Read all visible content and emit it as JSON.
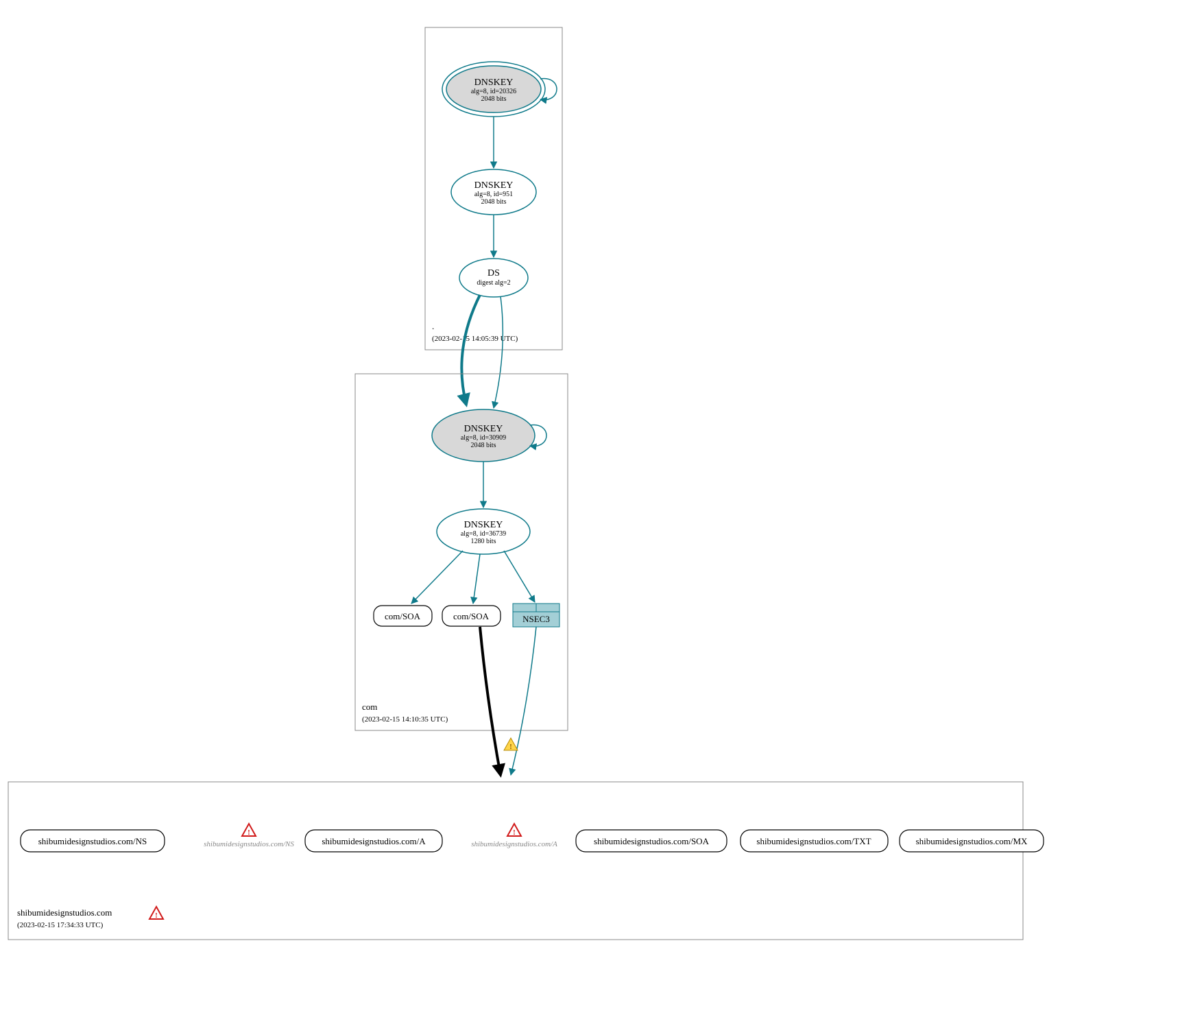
{
  "zones": {
    "root": {
      "label": ".",
      "timestamp": "(2023-02-15 14:05:39 UTC)",
      "ksk": {
        "title": "DNSKEY",
        "alg": "alg=8, id=20326",
        "bits": "2048 bits"
      },
      "zsk": {
        "title": "DNSKEY",
        "alg": "alg=8, id=951",
        "bits": "2048 bits"
      },
      "ds": {
        "title": "DS",
        "alg": "digest alg=2"
      }
    },
    "com": {
      "label": "com",
      "timestamp": "(2023-02-15 14:10:35 UTC)",
      "ksk": {
        "title": "DNSKEY",
        "alg": "alg=8, id=30909",
        "bits": "2048 bits"
      },
      "zsk": {
        "title": "DNSKEY",
        "alg": "alg=8, id=36739",
        "bits": "1280 bits"
      },
      "soa1": "com/SOA",
      "soa2": "com/SOA",
      "nsec3": "NSEC3"
    },
    "domain": {
      "label": "shibumidesignstudios.com",
      "timestamp": "(2023-02-15 17:34:33 UTC)",
      "rr": {
        "ns": "shibumidesignstudios.com/NS",
        "ns_g": "shibumidesignstudios.com/NS",
        "a": "shibumidesignstudios.com/A",
        "a_g": "shibumidesignstudios.com/A",
        "soa": "shibumidesignstudios.com/SOA",
        "txt": "shibumidesignstudios.com/TXT",
        "mx": "shibumidesignstudios.com/MX"
      }
    }
  }
}
